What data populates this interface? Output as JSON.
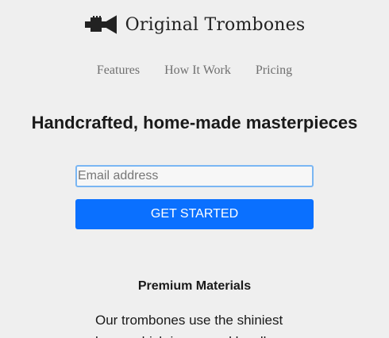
{
  "header": {
    "logo_icon": "trumpet-icon",
    "brand": "Original Trombones"
  },
  "nav": {
    "items": [
      {
        "label": "Features"
      },
      {
        "label": "How It Work"
      },
      {
        "label": "Pricing"
      }
    ]
  },
  "hero": {
    "title": "Handcrafted, home-made masterpieces",
    "email_placeholder": "Email address",
    "email_value": "",
    "cta_label": "GET STARTED"
  },
  "features": [
    {
      "title": "Premium Materials",
      "text": "Our trombones use the shiniest brass which is sourced locally."
    }
  ],
  "colors": {
    "background": "#efefef",
    "accent": "#0a70ff",
    "input_focus_border": "#7ab6f3",
    "nav_text": "#6f6f6f"
  }
}
